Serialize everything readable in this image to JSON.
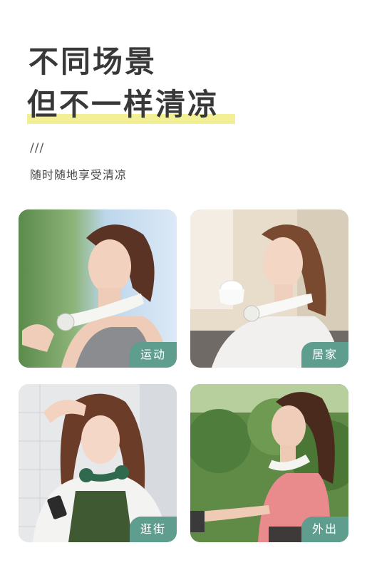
{
  "heading": {
    "line1": "不同场景",
    "line2": "但不一样清凉",
    "divider": "///",
    "subtitle": "随时随地享受清凉",
    "highlight_color": "#f3ef95"
  },
  "scenes": [
    {
      "label": "运动"
    },
    {
      "label": "居家"
    },
    {
      "label": "逛街"
    },
    {
      "label": "外出"
    }
  ],
  "badge_color": "#5f9e8f"
}
